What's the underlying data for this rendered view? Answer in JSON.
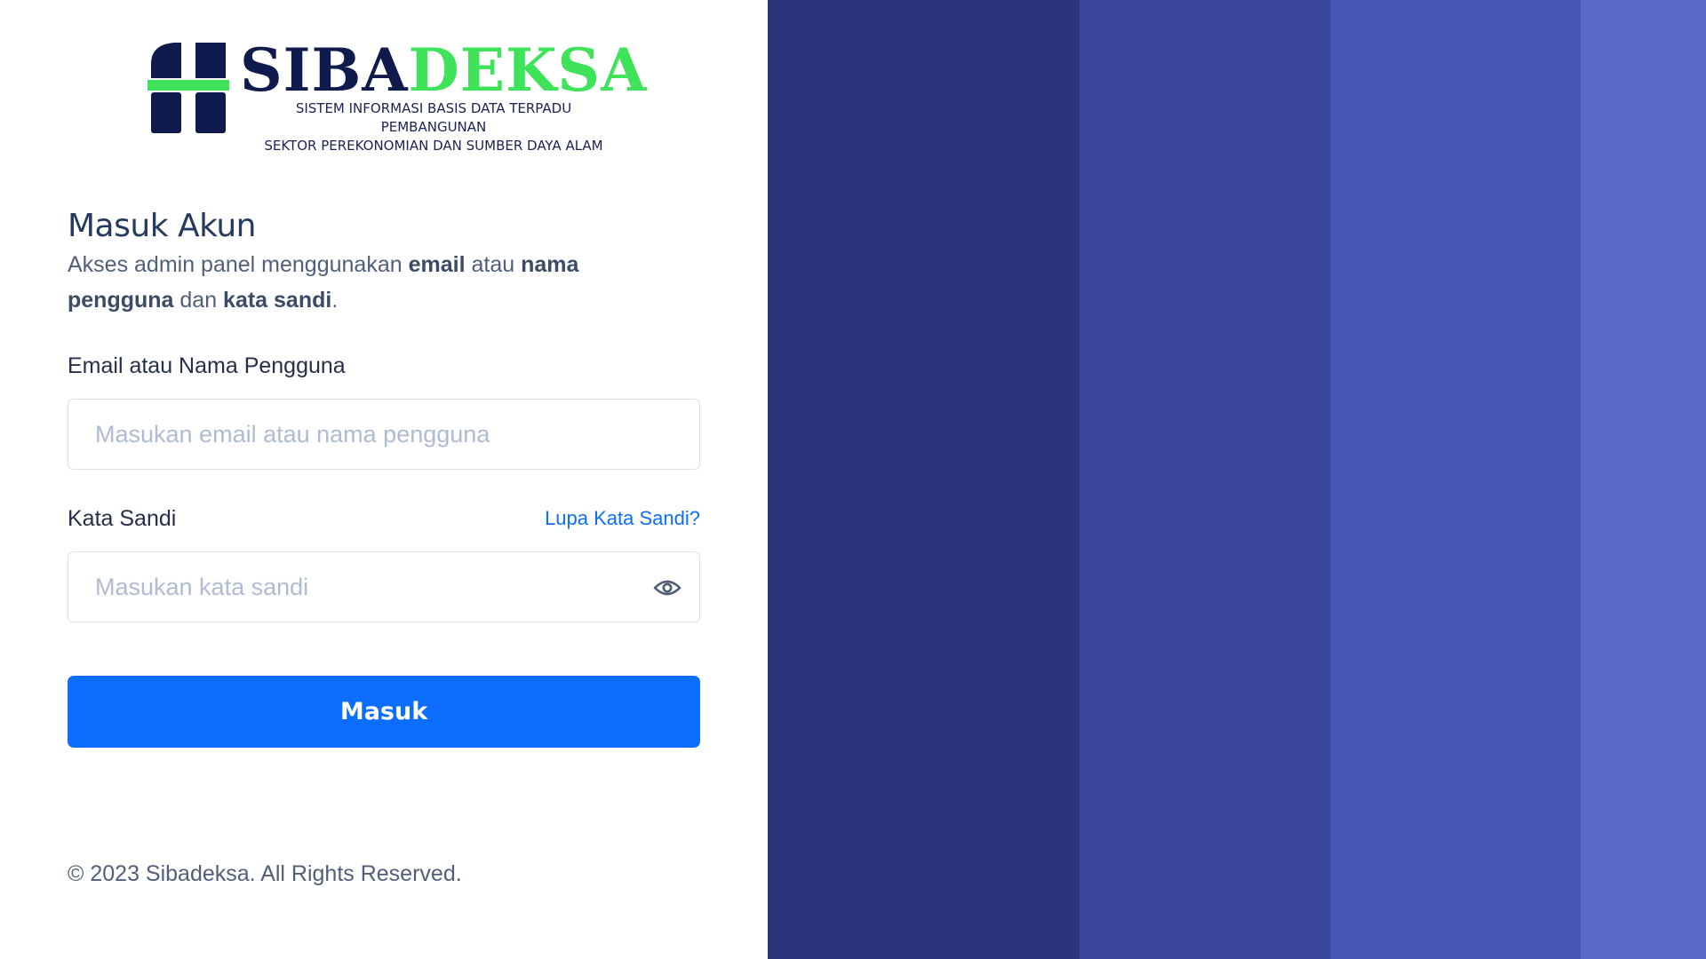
{
  "brand": {
    "word_part1": "SIBA",
    "word_part2": "DEKSA",
    "subtitle_line1": "SISTEM INFORMASI BASIS DATA TERPADU PEMBANGUNAN",
    "subtitle_line2": "SEKTOR PEREKONOMIAN DAN SUMBER DAYA ALAM",
    "colors": {
      "navy": "#0f1a4d",
      "green": "#3ee35a"
    }
  },
  "login": {
    "title": "Masuk Akun",
    "desc_1": "Akses admin panel menggunakan ",
    "desc_email": "email",
    "desc_2": " atau ",
    "desc_nama": "nama pengguna",
    "desc_3": " dan ",
    "desc_katasandi": "kata sandi",
    "desc_4": ".",
    "email_label": "Email atau Nama Pengguna",
    "email_placeholder": "Masukan email atau nama pengguna",
    "email_value": "",
    "password_label": "Kata Sandi",
    "forgot_label": "Lupa Kata Sandi?",
    "password_placeholder": "Masukan kata sandi",
    "password_value": "",
    "password_toggle_icon": "eye-icon",
    "submit_label": "Masuk"
  },
  "footer": {
    "copyright": "© 2023 Sibadeksa. All Rights Reserved."
  },
  "theme": {
    "accent": "#0d6efd",
    "stripes": [
      "#2b357c",
      "#3a459e",
      "#4756b6",
      "#5b69c8"
    ]
  }
}
